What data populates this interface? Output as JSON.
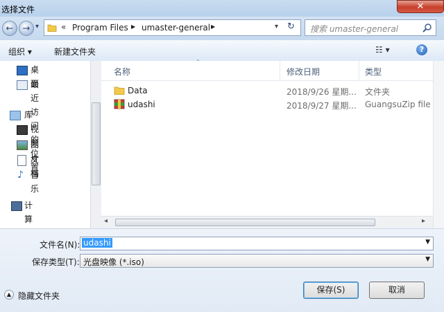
{
  "window": {
    "title": "选择文件",
    "close_glyph": "✕"
  },
  "nav": {
    "back_glyph": "←",
    "forward_glyph": "→",
    "dropdown_glyph": "▾",
    "refresh_glyph": "↻"
  },
  "address": {
    "prefix": "«",
    "segments": [
      "Program Files",
      "umaster-general"
    ],
    "separator": "▶"
  },
  "search": {
    "placeholder": "搜索 umaster-general"
  },
  "toolbar": {
    "organize": "组织 ▾",
    "new_folder": "新建文件夹",
    "view_glyph": "☷ ▾",
    "help_glyph": "?"
  },
  "sidebar": {
    "items": [
      {
        "label": "桌面",
        "icon": "desktop-icon"
      },
      {
        "label": "最近访问的位置",
        "icon": "recent-places-icon"
      },
      {
        "label": "库",
        "icon": "library-icon"
      },
      {
        "label": "视频",
        "icon": "video-icon"
      },
      {
        "label": "图片",
        "icon": "pictures-icon"
      },
      {
        "label": "文档",
        "icon": "documents-icon"
      },
      {
        "label": "音乐",
        "icon": "music-icon"
      },
      {
        "label": "计算机",
        "icon": "computer-icon"
      }
    ]
  },
  "files": {
    "columns": [
      "名称",
      "修改日期",
      "类型"
    ],
    "rows": [
      {
        "name": "Data",
        "date": "2018/9/26 星期...",
        "type": "文件夹",
        "icon": "folder-icon"
      },
      {
        "name": "udashi",
        "date": "2018/9/27 星期...",
        "type": "GuangsuZip file",
        "icon": "archive-icon"
      }
    ]
  },
  "form": {
    "filename_label": "文件名(N):",
    "filename_value": "udashi",
    "filetype_label": "保存类型(T):",
    "filetype_value": "光盘映像 (*.iso)"
  },
  "footer": {
    "hide_folders": "隐藏文件夹",
    "save": "保存(S)",
    "cancel": "取消"
  }
}
